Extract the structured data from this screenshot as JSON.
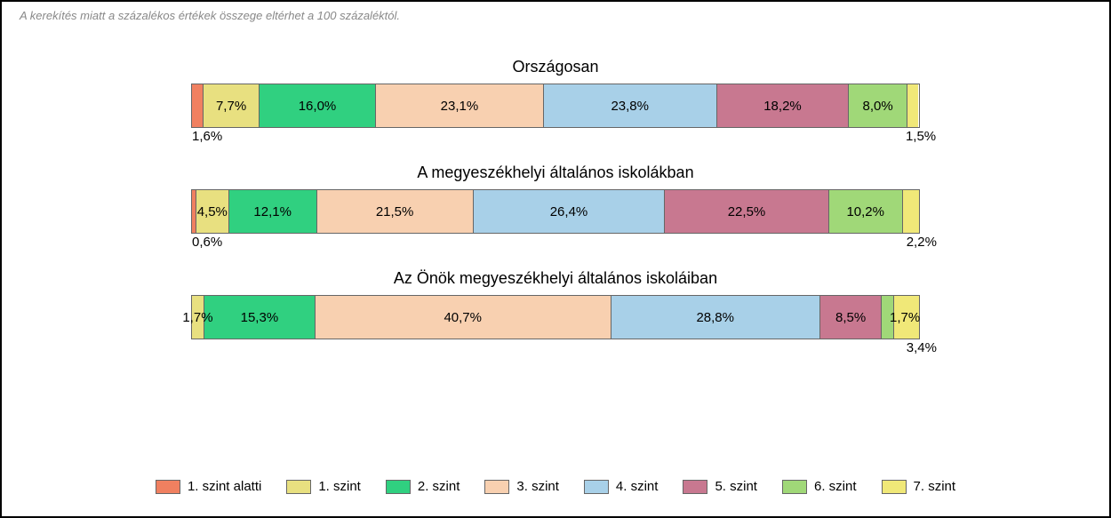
{
  "note": "A kerekítés miatt a százalékos értékek összege eltérhet a 100 százaléktól.",
  "chart_data": {
    "type": "bar",
    "stacked": true,
    "orientation": "horizontal",
    "categories": [
      "Országosan",
      "A megyeszékhelyi általános iskolákban",
      "Az Önök megyeszékhelyi általános iskoláiban"
    ],
    "series": [
      {
        "name": "1. szint alatti",
        "color": "#f08060",
        "values": [
          1.6,
          0.6,
          0.0
        ]
      },
      {
        "name": "1. szint",
        "color": "#e8e080",
        "values": [
          7.7,
          4.5,
          1.7
        ]
      },
      {
        "name": "2. szint",
        "color": "#30d080",
        "values": [
          16.0,
          12.1,
          15.3
        ]
      },
      {
        "name": "3. szint",
        "color": "#f8d0b0",
        "values": [
          23.1,
          21.5,
          40.7
        ]
      },
      {
        "name": "4. szint",
        "color": "#a8d0e8",
        "values": [
          23.8,
          26.4,
          28.8
        ]
      },
      {
        "name": "5. szint",
        "color": "#c87890",
        "values": [
          18.2,
          22.5,
          8.5
        ]
      },
      {
        "name": "6. szint",
        "color": "#a0d878",
        "values": [
          8.0,
          10.2,
          1.7
        ]
      },
      {
        "name": "7. szint",
        "color": "#f0e878",
        "values": [
          1.5,
          2.2,
          3.4
        ]
      }
    ],
    "title": "",
    "xlabel": "",
    "ylabel": ""
  },
  "labels": {
    "bar1": {
      "title": "Országosan",
      "segs": [
        {
          "v": "1,6%",
          "pos": "below"
        },
        {
          "v": "7,7%",
          "pos": "inside"
        },
        {
          "v": "16,0%",
          "pos": "inside"
        },
        {
          "v": "23,1%",
          "pos": "inside"
        },
        {
          "v": "23,8%",
          "pos": "inside"
        },
        {
          "v": "18,2%",
          "pos": "inside"
        },
        {
          "v": "8,0%",
          "pos": "inside"
        },
        {
          "v": "1,5%",
          "pos": "below-right"
        }
      ]
    },
    "bar2": {
      "title": "A megyeszékhelyi általános iskolákban",
      "segs": [
        {
          "v": "0,6%",
          "pos": "below"
        },
        {
          "v": "4,5%",
          "pos": "inside"
        },
        {
          "v": "12,1%",
          "pos": "inside"
        },
        {
          "v": "21,5%",
          "pos": "inside"
        },
        {
          "v": "26,4%",
          "pos": "inside"
        },
        {
          "v": "22,5%",
          "pos": "inside"
        },
        {
          "v": "10,2%",
          "pos": "inside"
        },
        {
          "v": "2,2%",
          "pos": "below-right"
        }
      ]
    },
    "bar3": {
      "title": "Az Önök megyeszékhelyi általános iskoláiban",
      "segs": [
        {
          "v": "",
          "pos": "none"
        },
        {
          "v": "1,7%",
          "pos": "inside"
        },
        {
          "v": "15,3%",
          "pos": "inside"
        },
        {
          "v": "40,7%",
          "pos": "inside"
        },
        {
          "v": "28,8%",
          "pos": "inside"
        },
        {
          "v": "8,5%",
          "pos": "inside"
        },
        {
          "v": "1,7%",
          "pos": "inside-shift"
        },
        {
          "v": "3,4%",
          "pos": "below-right"
        }
      ]
    }
  },
  "legend": [
    {
      "name": "1. szint alatti"
    },
    {
      "name": "1. szint"
    },
    {
      "name": "2. szint"
    },
    {
      "name": "3. szint"
    },
    {
      "name": "4. szint"
    },
    {
      "name": "5. szint"
    },
    {
      "name": "6. szint"
    },
    {
      "name": "7. szint"
    }
  ]
}
